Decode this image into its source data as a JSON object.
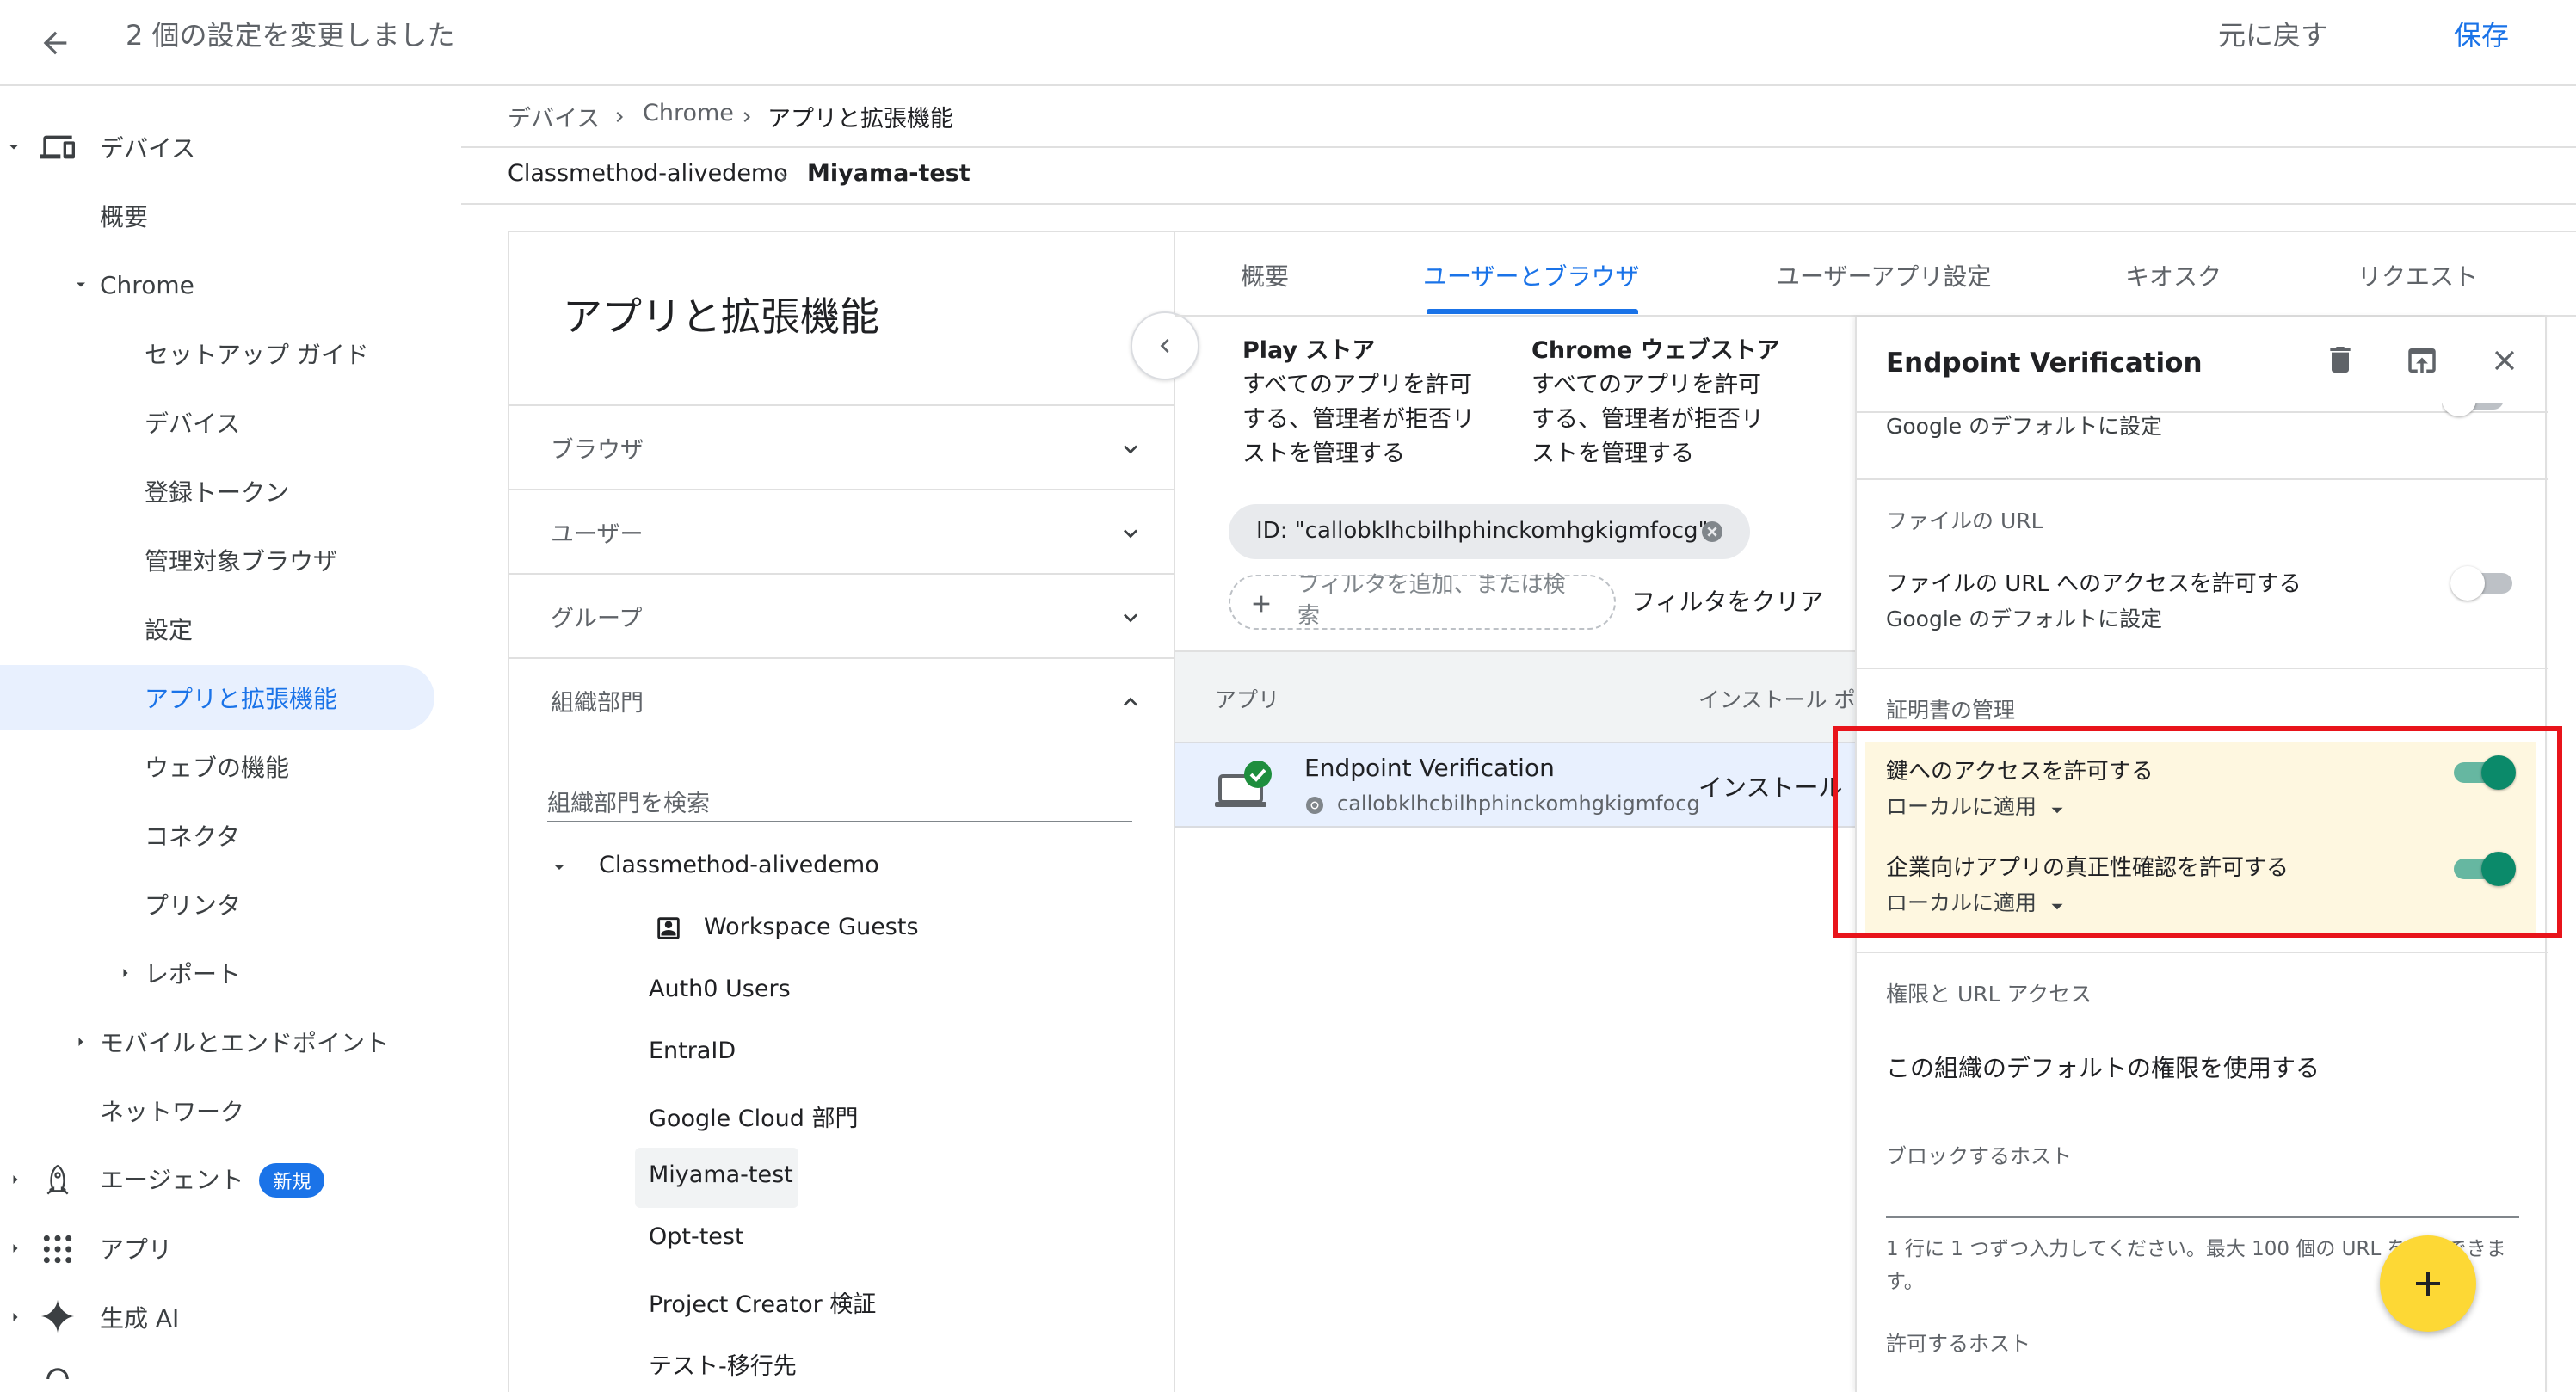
{
  "topbar": {
    "title": "2 個の設定を変更しました",
    "undo_label": "元に戻す",
    "save_label": "保存"
  },
  "breadcrumb": {
    "items": [
      "デバイス",
      "Chrome",
      "アプリと拡張機能"
    ],
    "org_items": [
      "Classmethod-alivedemo",
      "Miyama-test"
    ]
  },
  "sidebar": {
    "devices": "デバイス",
    "overview": "概要",
    "chrome": "Chrome",
    "setup_guide": "セットアップ ガイド",
    "devices_sub": "デバイス",
    "enrollment_token": "登録トークン",
    "managed_browsers": "管理対象ブラウザ",
    "settings": "設定",
    "apps_extensions": "アプリと拡張機能",
    "web_features": "ウェブの機能",
    "connectors": "コネクタ",
    "printers": "プリンタ",
    "reports": "レポート",
    "mobile_endpoints": "モバイルとエンドポイント",
    "network": "ネットワーク",
    "agents": "エージェント",
    "new_badge": "新規",
    "apps": "アプリ",
    "generative_ai": "生成 AI"
  },
  "left_panel": {
    "title": "アプリと拡張機能",
    "sections": [
      "ブラウザ",
      "ユーザー",
      "グループ",
      "組織部門"
    ],
    "search_placeholder": "組織部門を検索",
    "org_root": "Classmethod-alivedemo",
    "org_units": [
      "Workspace Guests",
      "Auth0 Users",
      "EntraID",
      "Google Cloud 部門",
      "Miyama-test",
      "Opt-test",
      "Project Creator 検証",
      "テスト-移行先"
    ],
    "selected_org": "Miyama-test"
  },
  "tabs": {
    "items": [
      "概要",
      "ユーザーとブラウザ",
      "ユーザーアプリ設定",
      "キオスク",
      "リクエスト"
    ],
    "active": "ユーザーとブラウザ"
  },
  "stores": {
    "play_title": "Play ストア",
    "play_lines": [
      "すべてのアプリを許可",
      "する、管理者が拒否リ",
      "ストを管理する"
    ],
    "web_title": "Chrome ウェブストア",
    "web_lines": [
      "すべてのアプリを許可",
      "する、管理者が拒否リ",
      "ストを管理する"
    ]
  },
  "filters": {
    "chip_label": "ID: \"callobklhcbilhphinckomhgkigmfocg\"",
    "add_filter_line1": "フィルタを追加、または検",
    "add_filter_line2": "索",
    "clear_label": "フィルタをクリア"
  },
  "table": {
    "col_app": "アプリ",
    "col_install": "インストール ポリ",
    "row_name": "Endpoint Verification",
    "row_id": "callobklhcbilhphinckomhgkigmfocg",
    "row_install": "インストール"
  },
  "detail": {
    "title": "Endpoint Verification",
    "top_sub": "Google のデフォルトに設定",
    "file_url_header": "ファイルの URL",
    "file_url_label": "ファイルの URL へのアクセスを許可する",
    "file_url_sub": "Google のデフォルトに設定",
    "cert_header": "証明書の管理",
    "key_access_label": "鍵へのアクセスを許可する",
    "key_access_sub": "ローカルに適用",
    "enterprise_label": "企業向けアプリの真正性確認を許可する",
    "enterprise_sub": "ローカルに適用",
    "perm_header": "権限と URL アクセス",
    "perm_default": "この組織のデフォルトの権限を使用する",
    "blocked_hosts_label": "ブロックするホスト",
    "hint_line1": "1 行に 1 つずつ入力してください。最大 100 個の URL を指定できま",
    "hint_line2": "す。",
    "allowed_hosts_label": "許可するホスト"
  },
  "colors": {
    "accent": "#1a73e8",
    "toggle_on": "#0b8a6a",
    "highlight_bg": "#fef7e0",
    "highlight_border": "#e8141b",
    "fab": "#fdd835",
    "selected_bg": "#e8f0fe"
  }
}
